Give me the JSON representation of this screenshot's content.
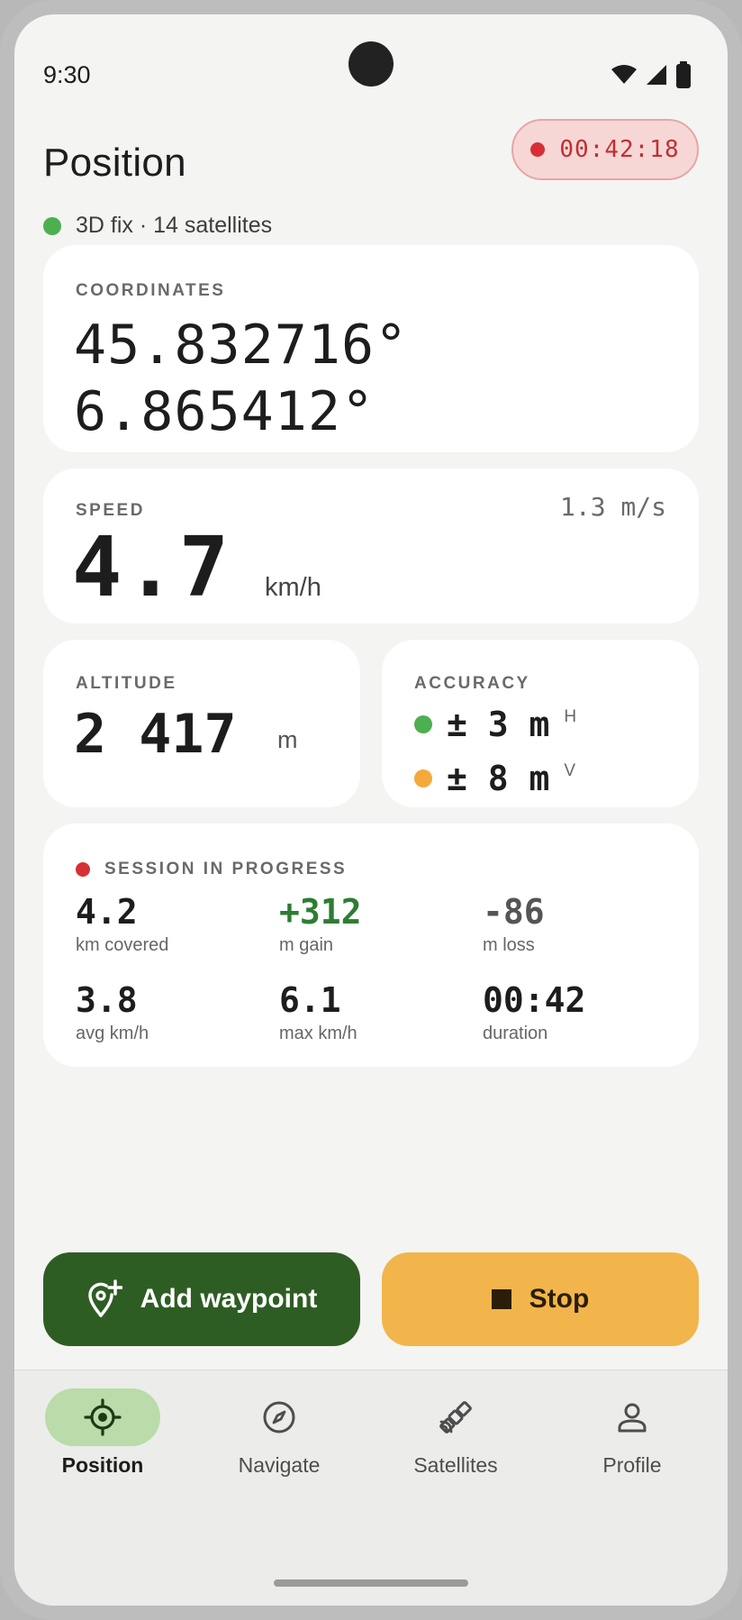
{
  "status_bar": {
    "time": "9:30"
  },
  "header": {
    "title": "Position",
    "recording_time": "00:42:18"
  },
  "fix": {
    "text": "3D fix · 14 satellites",
    "color": "#4caf50"
  },
  "coordinates": {
    "label": "COORDINATES",
    "latitude": "45.832716°",
    "longitude": "6.865412°"
  },
  "speed": {
    "label": "SPEED",
    "value": "4.7",
    "unit": "km/h",
    "secondary": "1.3 m/s"
  },
  "altitude": {
    "label": "ALTITUDE",
    "value": "2 417",
    "unit": "m"
  },
  "accuracy": {
    "label": "ACCURACY",
    "horizontal": {
      "value": "± 3 m",
      "axis": "H",
      "color": "#4caf50"
    },
    "vertical": {
      "value": "± 8 m",
      "axis": "V",
      "color": "#f5a93a"
    }
  },
  "session": {
    "label": "SESSION IN PROGRESS",
    "stats": [
      {
        "value": "4.2",
        "label": "km covered"
      },
      {
        "value": "+312",
        "label": "m gain",
        "color": "#2e7d32"
      },
      {
        "value": "-86",
        "label": "m loss",
        "color": "#555555"
      },
      {
        "value": "3.8",
        "label": "avg km/h"
      },
      {
        "value": "6.1",
        "label": "max km/h"
      },
      {
        "value": "00:42",
        "label": "duration"
      }
    ]
  },
  "actions": {
    "waypoint_label": "Add waypoint",
    "stop_label": "Stop"
  },
  "nav": {
    "items": [
      {
        "label": "Position",
        "icon": "crosshair-icon"
      },
      {
        "label": "Navigate",
        "icon": "compass-icon"
      },
      {
        "label": "Satellites",
        "icon": "satellite-icon"
      },
      {
        "label": "Profile",
        "icon": "person-icon"
      }
    ]
  },
  "colors": {
    "primary": "#2e5d24",
    "stop": "#f2b54c",
    "recording": "#d63036",
    "nav_active": "#b9dcaa"
  }
}
